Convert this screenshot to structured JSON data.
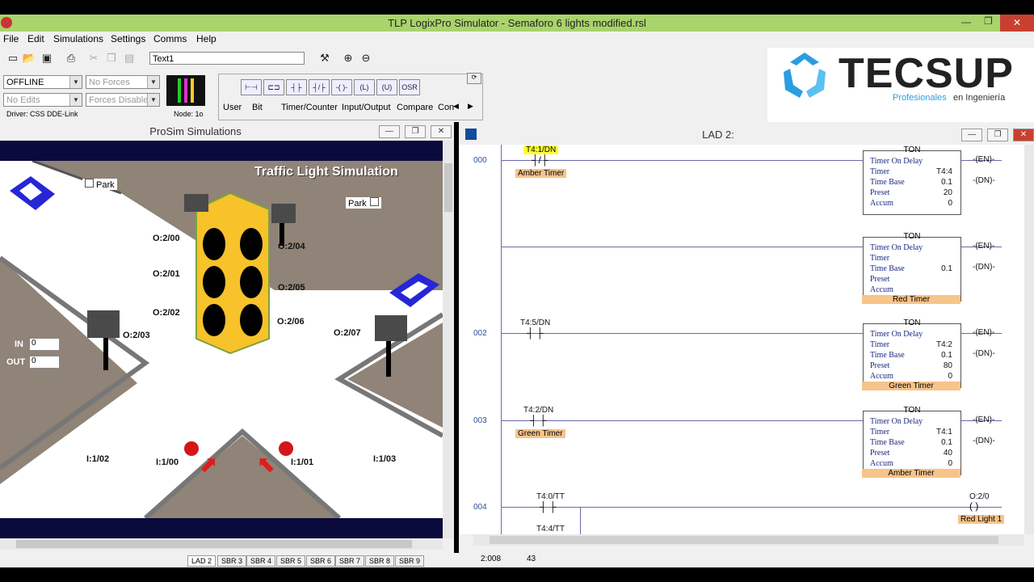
{
  "window": {
    "title": "TLP LogixPro Simulator  -  Semaforo 6 lights modified.rsl",
    "min": "—",
    "restore": "❐",
    "close": "✕"
  },
  "menu": [
    "File",
    "Edit",
    "Simulations",
    "Settings",
    "Comms",
    "Help"
  ],
  "toolbar": {
    "text_field": "Text1"
  },
  "panel": {
    "mode": "OFFLINE",
    "forces": "No Forces",
    "edits": "No Edits",
    "forces_state": "Forces Disabled",
    "driver": "Driver: CSS DDE-Link",
    "node": "Node: 1o",
    "osr": "OSR",
    "tabs": [
      "User",
      "Bit",
      "Timer/Counter",
      "Input/Output",
      "Compare",
      "Con"
    ]
  },
  "logo": {
    "name": "TECSUP",
    "tagline_a": "Profesionales",
    "tagline_b": "en Ingeniería"
  },
  "prosim": {
    "title": "ProSim Simulations",
    "scene_title": "Traffic Light Simulation",
    "park1": "Park",
    "park2": "Park",
    "in_label": "IN",
    "out_label": "OUT",
    "in_val": "0",
    "out_val": "0",
    "labels": {
      "o200": "O:2/00",
      "o201": "O:2/01",
      "o202": "O:2/02",
      "o203": "O:2/03",
      "o204": "O:2/04",
      "o205": "O:2/05",
      "o206": "O:2/06",
      "o207": "O:2/07",
      "i102": "I:1/02",
      "i100": "I:1/00",
      "i101": "I:1/01",
      "i103": "I:1/03"
    }
  },
  "lad": {
    "title": "LAD 2:",
    "rungs": [
      {
        "num": "000",
        "contact": "T4:1/DN",
        "contact_desc": "Amber Timer",
        "ton": {
          "title": "TON",
          "l1": "Timer On Delay",
          "l2": "Timer",
          "l3": "Time Base",
          "l4": "Preset",
          "l5": "Accum",
          "timer": "T4:4",
          "base": "0.1",
          "preset": "20",
          "accum": "0"
        }
      },
      {
        "num": "",
        "ton": {
          "title": "TON",
          "l1": "Timer On Delay",
          "l2": "Timer",
          "l3": "Time Base",
          "l4": "Preset",
          "l5": "Accum",
          "timer": "",
          "base": "0.1",
          "preset": "",
          "accum": "",
          "desc": "Red Timer"
        }
      },
      {
        "num": "002",
        "contact": "T4:5/DN",
        "ton": {
          "title": "TON",
          "l1": "Timer On Delay",
          "l2": "Timer",
          "l3": "Time Base",
          "l4": "Preset",
          "l5": "Accum",
          "timer": "T4:2",
          "base": "0.1",
          "preset": "80",
          "accum": "0",
          "desc": "Green Timer"
        }
      },
      {
        "num": "003",
        "contact": "T4:2/DN",
        "contact_desc": "Green Timer",
        "ton": {
          "title": "TON",
          "l1": "Timer On Delay",
          "l2": "Timer",
          "l3": "Time Base",
          "l4": "Preset",
          "l5": "Accum",
          "timer": "T4:1",
          "base": "0.1",
          "preset": "40",
          "accum": "0",
          "desc": "Amber Timer"
        }
      },
      {
        "num": "004",
        "contact": "T4:0/TT",
        "contact2": "T4:4/TT",
        "coil": "O:2/0",
        "coil_desc": "Red Light 1"
      }
    ],
    "en": "EN",
    "dn": "DN"
  },
  "status": {
    "tabs": [
      "LAD 2",
      "SBR 3",
      "SBR 4",
      "SBR 5",
      "SBR 6",
      "SBR 7",
      "SBR 8",
      "SBR 9"
    ],
    "addr": "2:008",
    "num": "43"
  }
}
